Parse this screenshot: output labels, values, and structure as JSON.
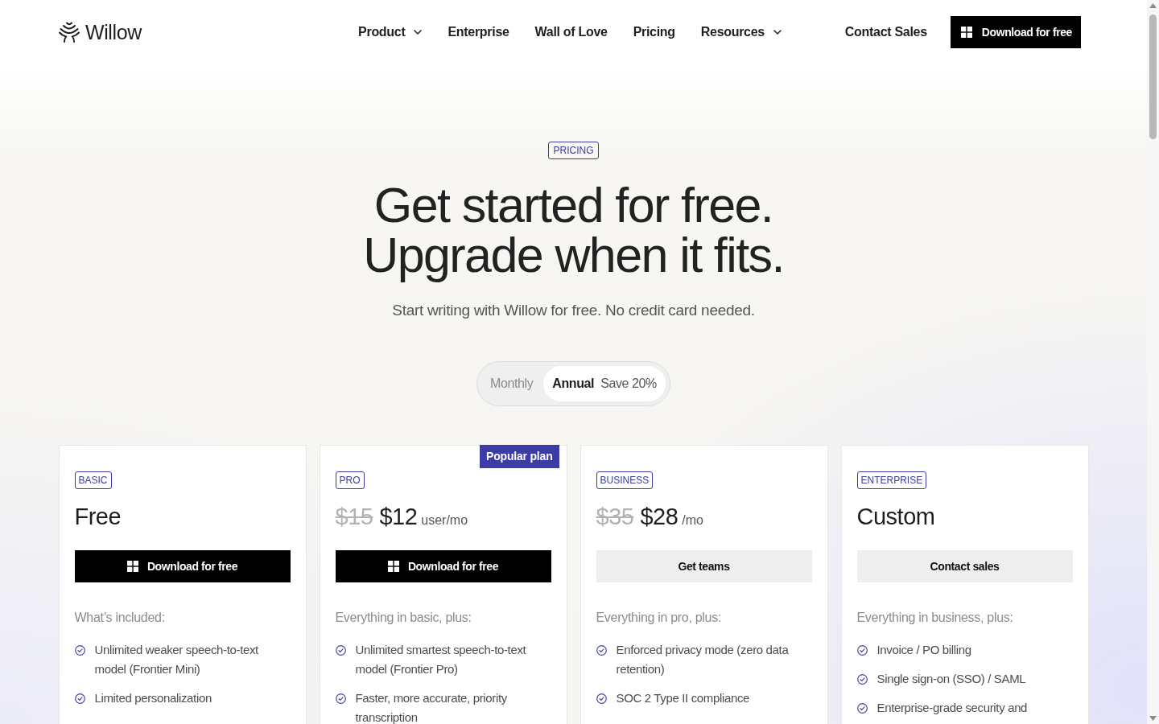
{
  "header": {
    "logo": "Willow",
    "nav": [
      {
        "label": "Product",
        "dropdown": true
      },
      {
        "label": "Enterprise",
        "dropdown": false
      },
      {
        "label": "Wall of Love",
        "dropdown": false
      },
      {
        "label": "Pricing",
        "dropdown": false
      },
      {
        "label": "Resources",
        "dropdown": true
      }
    ],
    "contact_link": "Contact Sales",
    "download_button": "Download for free"
  },
  "hero": {
    "badge": "PRICING",
    "title_lines": [
      "Get started for free.",
      "Upgrade when it fits."
    ],
    "subtitle": "Start writing with Willow for free. No credit card needed.",
    "billing_options": [
      {
        "label": "Monthly",
        "selected": false
      },
      {
        "label": "Annual",
        "note": "Save 20%",
        "selected": true
      }
    ]
  },
  "plans": [
    {
      "tier": "BASIC",
      "price": "Free",
      "button": {
        "label": "Download for free",
        "kind": "primary"
      },
      "features_title": "What’s included:",
      "features": [
        "Unlimited weaker speech-to-text model (Frontier Mini)",
        "Limited personalization"
      ]
    },
    {
      "tier": "PRO",
      "ribbon": "Popular plan",
      "old_price": "$15",
      "price": "$12",
      "unit": "user/mo",
      "button": {
        "label": "Download for free",
        "kind": "primary"
      },
      "features_title": "Everything in basic, plus:",
      "features": [
        "Unlimited smartest speech-to-text model (Frontier Pro)",
        "Faster, more accurate, priority transcription"
      ]
    },
    {
      "tier": "BUSINESS",
      "old_price": "$35",
      "price": "$28",
      "unit": "/mo",
      "button": {
        "label": "Get teams",
        "kind": "secondary"
      },
      "features_title": "Everything in pro, plus:",
      "features": [
        "Enforced privacy mode (zero data retention)",
        "SOC 2 Type II compliance"
      ]
    },
    {
      "tier": "ENTERPRISE",
      "price": "Custom",
      "button": {
        "label": "Contact sales",
        "kind": "secondary"
      },
      "features_title": "Everything in business, plus:",
      "features": [
        "Invoice / PO billing",
        "Single sign-on (SSO) / SAML",
        "Enterprise-grade security and"
      ]
    }
  ]
}
